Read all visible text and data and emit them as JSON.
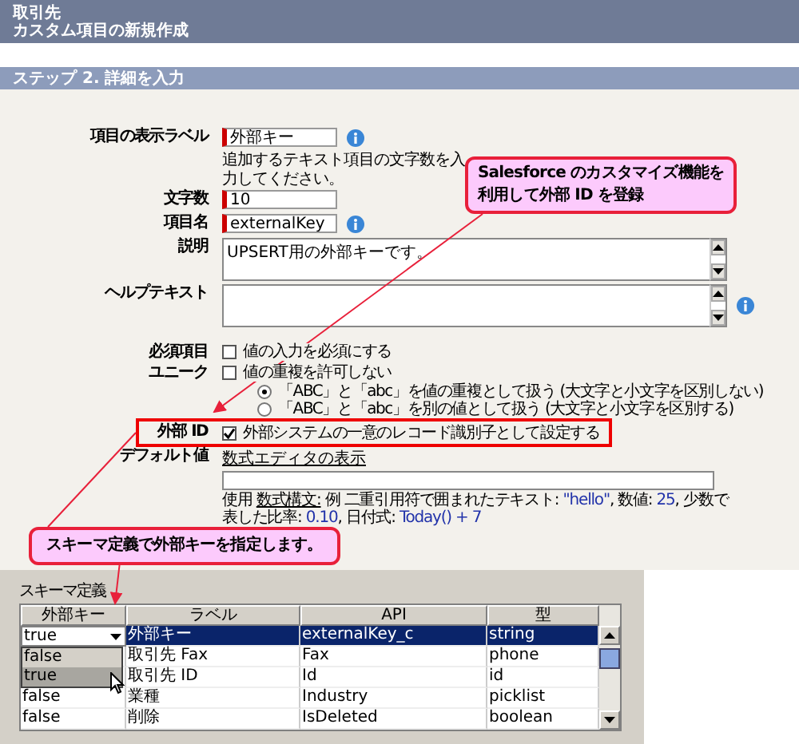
{
  "header": {
    "object": "取引先",
    "title": "カスタム項目の新規作成"
  },
  "step": {
    "title": "ステップ 2. 詳細を入力"
  },
  "fields": [
    {
      "kind": "text",
      "label": "項目の表示ラベル",
      "value": "外部キー",
      "required": true,
      "info": true
    },
    {
      "kind": "hint",
      "text": "追加するテキスト項目の文字数を入力してください。"
    },
    {
      "kind": "text",
      "label": "文字数",
      "value": "10",
      "required": true,
      "info": false
    },
    {
      "kind": "text",
      "label": "項目名",
      "value": "externalKey",
      "required": true,
      "info": true
    },
    {
      "kind": "textarea",
      "label": "説明",
      "value": "UPSERT用の外部キーです。",
      "info": false
    },
    {
      "kind": "textarea",
      "label": "ヘルプテキスト",
      "info": true
    }
  ],
  "options": [
    {
      "kind": "checkbox",
      "label": "必須項目",
      "text": "値の入力を必須にする",
      "checked": false,
      "highlighted": false
    },
    {
      "kind": "checkbox",
      "label": "ユニーク",
      "text": "値の重複を許可しない",
      "checked": false,
      "highlighted": false
    },
    {
      "kind": "radio",
      "text": "「ABC」と「abc」を値の重複として扱う (大文字と小文字を区別しない)",
      "selected": true
    },
    {
      "kind": "radio",
      "text": "「ABC」と「abc」を別の値として扱う (大文字と小文字を区別する)",
      "selected": false
    },
    {
      "kind": "checkbox",
      "label": "外部 ID",
      "text": "外部システムの一意のレコード識別子として設定する",
      "checked": true,
      "highlighted": true
    }
  ],
  "default_value": {
    "label": "デフォルト値",
    "link": "数式エディタの表示",
    "usage": [
      {
        "kind": "plain",
        "text": "使用 "
      },
      {
        "kind": "link",
        "text": "数式構文:"
      },
      {
        "kind": "plain",
        "text": " 例 二重引用符で囲まれたテキスト: "
      },
      {
        "kind": "value",
        "text": "\"hello\""
      },
      {
        "kind": "plain",
        "text": ", 数値: "
      },
      {
        "kind": "value",
        "text": "25"
      },
      {
        "kind": "plain",
        "text": ", 少数で表した比率: "
      },
      {
        "kind": "value",
        "text": "0.10"
      },
      {
        "kind": "plain",
        "text": ", 日付式: "
      },
      {
        "kind": "value",
        "text": "Today() + 7"
      }
    ]
  },
  "callouts": [
    {
      "lines": [
        "Salesforce のカスタマイズ機能を",
        "利用して外部 ID を登録"
      ]
    },
    {
      "lines": [
        "スキーマ定義で外部キーを指定します。"
      ]
    }
  ],
  "schema": {
    "title": "スキーマ定義",
    "columns": [
      "外部キー",
      "ラベル",
      "API",
      "型"
    ],
    "rows": [
      {
        "column_1": "true",
        "label": "外部キー",
        "api": "externalKey_c",
        "type": "string",
        "selected": true
      },
      {
        "label": "取引先 Fax",
        "api": "Fax",
        "type": "phone",
        "selected": false
      },
      {
        "label": "取引先 ID",
        "api": "Id",
        "type": "id",
        "selected": false
      },
      {
        "column_1": "false",
        "label": "業種",
        "api": "Industry",
        "type": "picklist",
        "selected": false
      },
      {
        "column_1": "false",
        "label": "削除",
        "api": "IsDeleted",
        "type": "boolean",
        "selected": false
      }
    ],
    "dropdown": [
      {
        "text": "false",
        "selected": false
      },
      {
        "text": "true",
        "selected": true
      }
    ]
  }
}
